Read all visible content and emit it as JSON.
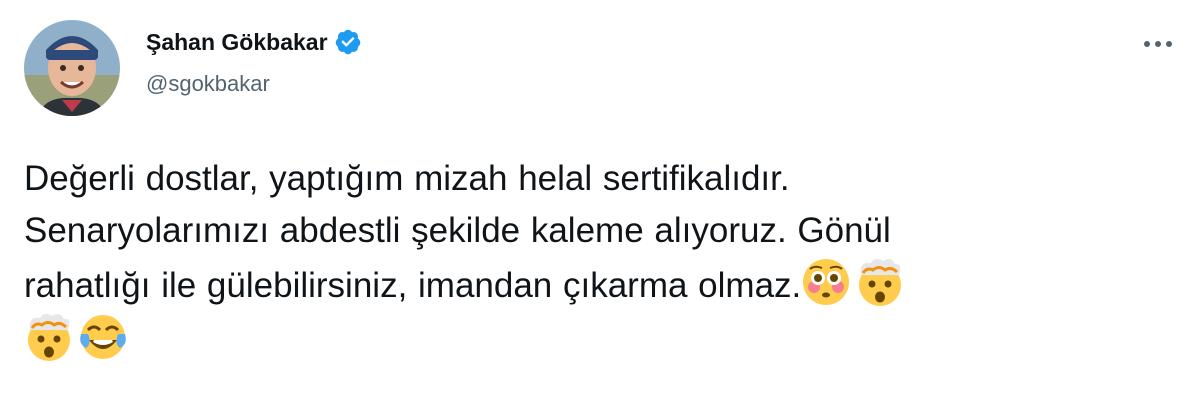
{
  "author": {
    "display_name": "Şahan Gökbakar",
    "handle": "@sgokbakar",
    "verified": true
  },
  "tweet": {
    "line1": "Değerli dostlar, yaptığım mizah helal sertifikalıdır.",
    "line2": "Senaryolarımızı abdestli şekilde kaleme alıyoruz. Gönül",
    "line3": "rahatlığı ile gülebilirsiniz, imandan çıkarma olmaz.",
    "emojis": [
      "flushed-face",
      "exploding-head",
      "exploding-head",
      "face-with-tears-of-joy"
    ]
  },
  "colors": {
    "text": "#0f1419",
    "secondary": "#536471",
    "verified": "#1d9bf0"
  }
}
